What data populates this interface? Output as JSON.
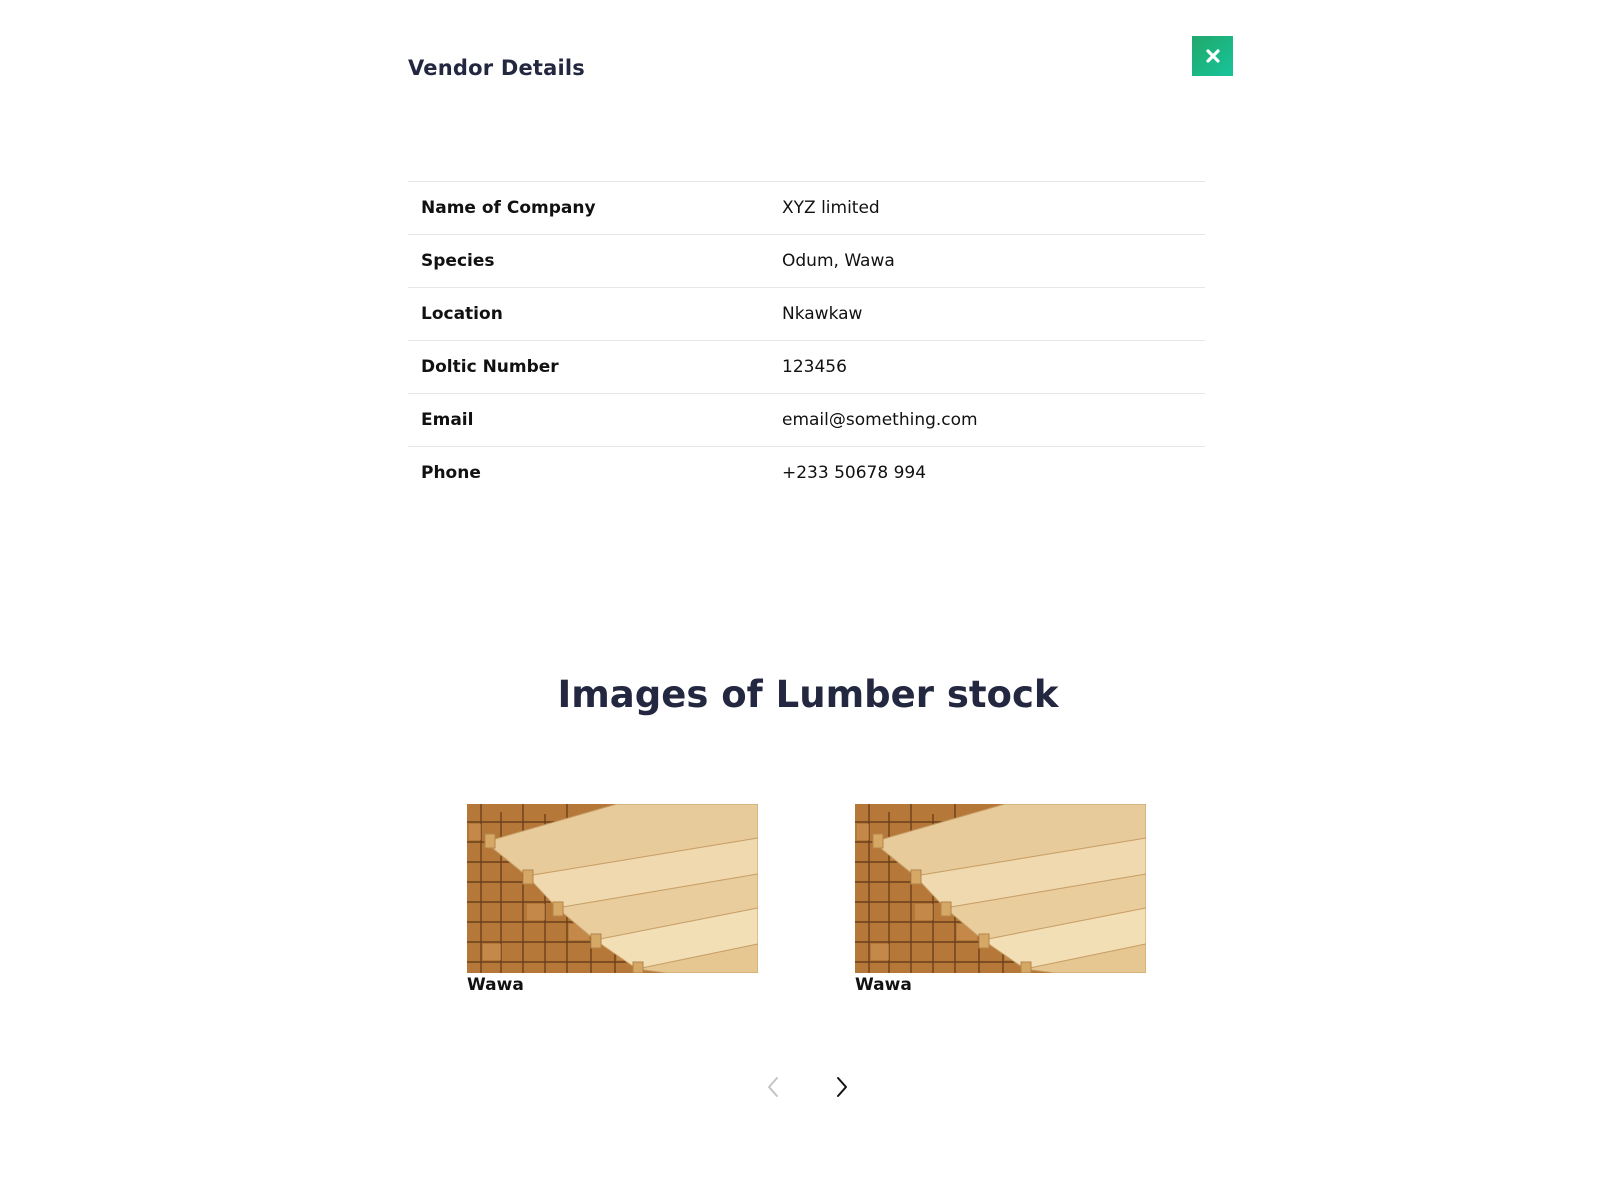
{
  "modal": {
    "title": "Vendor Details",
    "close_icon": "close-icon",
    "accent_color": "#1fb47f"
  },
  "details": [
    {
      "label": "Name of Company",
      "value": "XYZ limited"
    },
    {
      "label": "Species",
      "value": "Odum, Wawa"
    },
    {
      "label": "Location",
      "value": "Nkawkaw"
    },
    {
      "label": "Doltic Number",
      "value": "123456"
    },
    {
      "label": "Email",
      "value": "email@something.com"
    },
    {
      "label": "Phone",
      "value": "+233 50678 994"
    }
  ],
  "gallery": {
    "title": "Images of Lumber stock",
    "items": [
      {
        "caption": "Wawa",
        "image": "lumber-stack-photo"
      },
      {
        "caption": "Wawa",
        "image": "lumber-stack-photo"
      }
    ],
    "prev_icon": "chevron-left-icon",
    "next_icon": "chevron-right-icon"
  }
}
